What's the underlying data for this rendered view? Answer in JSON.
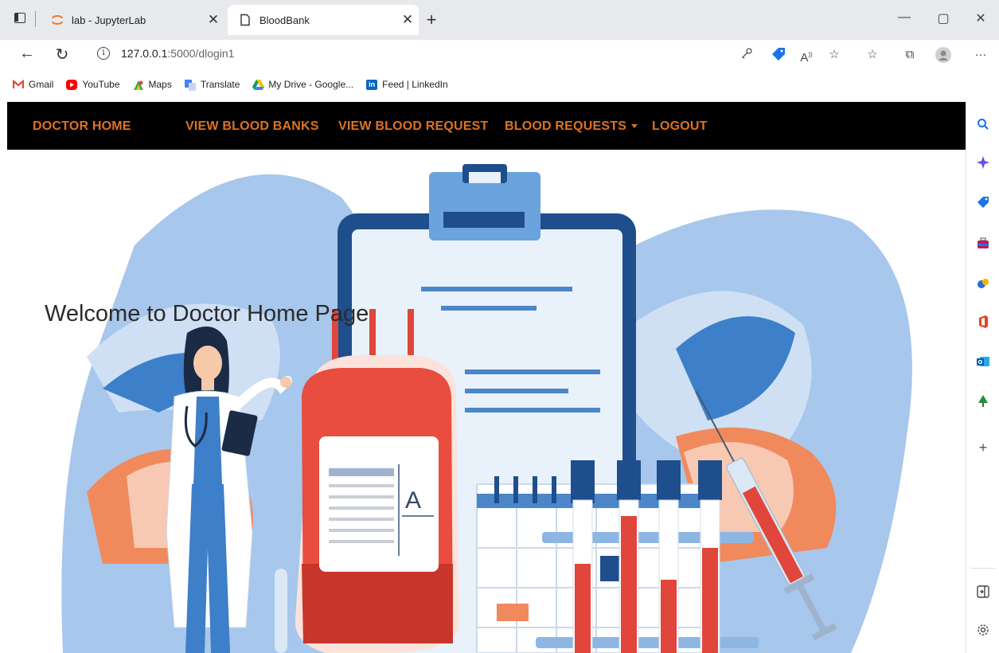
{
  "browser": {
    "tabs": [
      {
        "title": "lab - JupyterLab",
        "active": false,
        "close": "✕"
      },
      {
        "title": "BloodBank",
        "active": true,
        "close": "✕"
      }
    ],
    "new_tab": "+",
    "window_controls": {
      "minimize": "—",
      "restore": "▢",
      "close": "✕"
    },
    "address": {
      "host": "127.0.0.1",
      "path": ":5000/dlogin1"
    },
    "bookmarks": [
      {
        "label": "Gmail",
        "icon": "gmail-icon",
        "color": "#ea4335"
      },
      {
        "label": "YouTube",
        "icon": "youtube-icon",
        "color": "#ff0000"
      },
      {
        "label": "Maps",
        "icon": "maps-icon",
        "color": "#34a853"
      },
      {
        "label": "Translate",
        "icon": "translate-icon",
        "color": "#4285f4"
      },
      {
        "label": "My Drive - Google...",
        "icon": "drive-icon",
        "color": "#fbbc04"
      },
      {
        "label": "Feed | LinkedIn",
        "icon": "linkedin-icon",
        "color": "#0a66c2"
      }
    ]
  },
  "navbar": {
    "links": [
      "DOCTOR HOME",
      "VIEW BLOOD BANKS",
      "VIEW BLOOD REQUEST",
      "BLOOD REQUESTS",
      "LOGOUT"
    ],
    "link_color": "#e0711f",
    "background": "#000000"
  },
  "hero": {
    "welcome": "Welcome to Doctor Home Page",
    "blood_bag_label": "A"
  }
}
